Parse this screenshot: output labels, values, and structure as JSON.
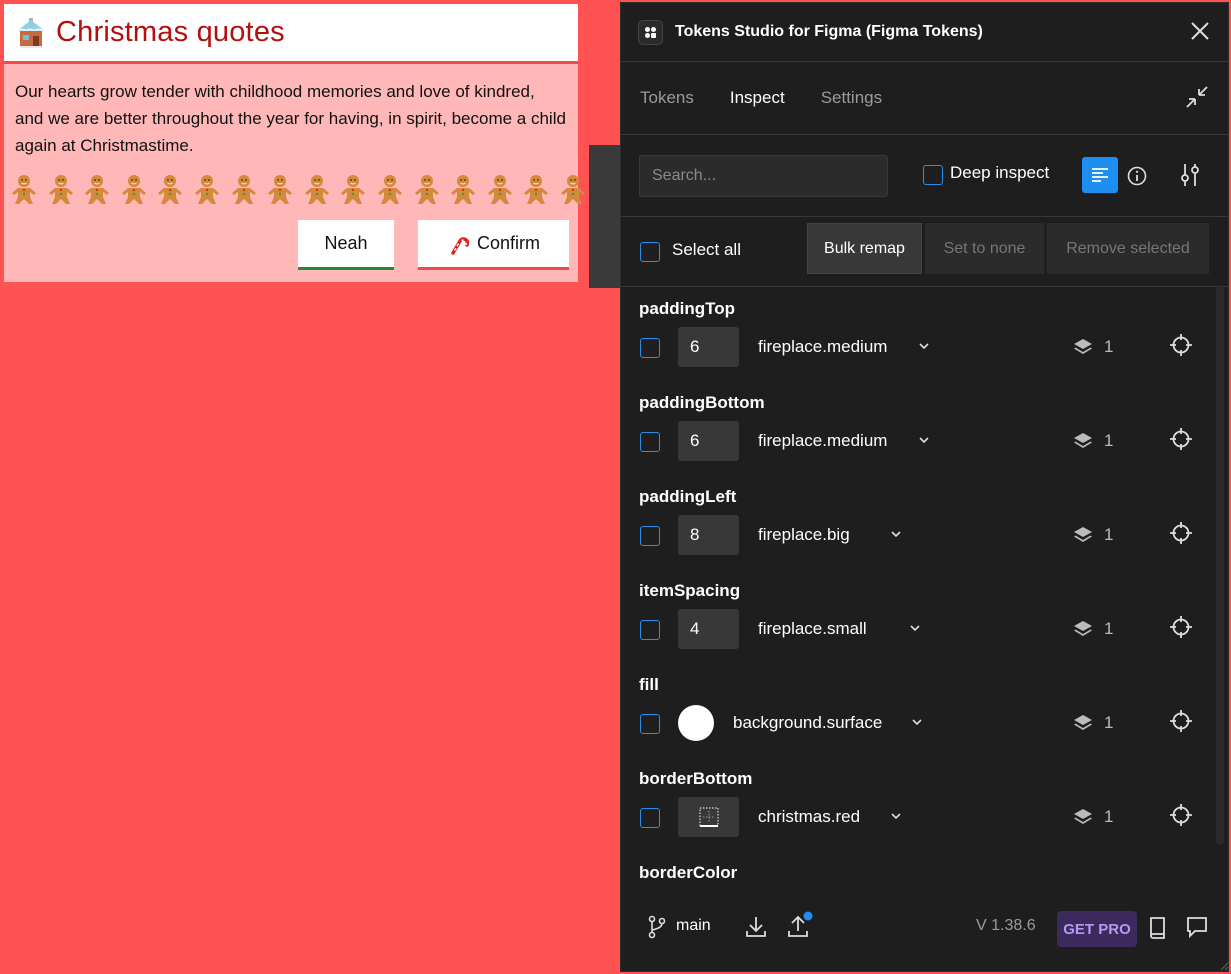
{
  "card": {
    "title": "Christmas quotes",
    "quote": "Our hearts grow tender with childhood memories and love of kindred, and we are better throughout the year for having, in spirit, become a child again at Christmastime.",
    "cookie_count": 16,
    "neah_label": "Neah",
    "confirm_label": "Confirm"
  },
  "panel": {
    "title": "Tokens Studio for Figma (Figma Tokens)",
    "tabs": [
      {
        "label": "Tokens"
      },
      {
        "label": "Inspect"
      },
      {
        "label": "Settings"
      }
    ],
    "active_tab": "Inspect",
    "search_placeholder": "Search...",
    "deep_inspect_label": "Deep inspect",
    "select_all_label": "Select all",
    "bulk_remap_label": "Bulk remap",
    "set_to_none_label": "Set to none",
    "remove_selected_label": "Remove selected",
    "groups": [
      {
        "name": "paddingTop",
        "value": "6",
        "token": "fireplace.medium",
        "count": "1",
        "kind": "number"
      },
      {
        "name": "paddingBottom",
        "value": "6",
        "token": "fireplace.medium",
        "count": "1",
        "kind": "number"
      },
      {
        "name": "paddingLeft",
        "value": "8",
        "token": "fireplace.big",
        "count": "1",
        "kind": "number"
      },
      {
        "name": "itemSpacing",
        "value": "4",
        "token": "fireplace.small",
        "count": "1",
        "kind": "number"
      },
      {
        "name": "fill",
        "value": "",
        "token": "background.surface",
        "count": "1",
        "kind": "color"
      },
      {
        "name": "borderBottom",
        "value": "",
        "token": "christmas.red",
        "count": "1",
        "kind": "border"
      },
      {
        "name": "borderColor",
        "value": "",
        "token": "",
        "count": "",
        "kind": "partial"
      }
    ],
    "footer": {
      "branch": "main",
      "version": "V 1.38.6",
      "get_pro": "GET PRO"
    }
  },
  "colors": {
    "background": "#ff5252",
    "card_bg": "#ffb7b7",
    "title_red": "#b40f0f",
    "accent_blue": "#1e8ff0",
    "panel_bg": "#1e1e1e"
  }
}
